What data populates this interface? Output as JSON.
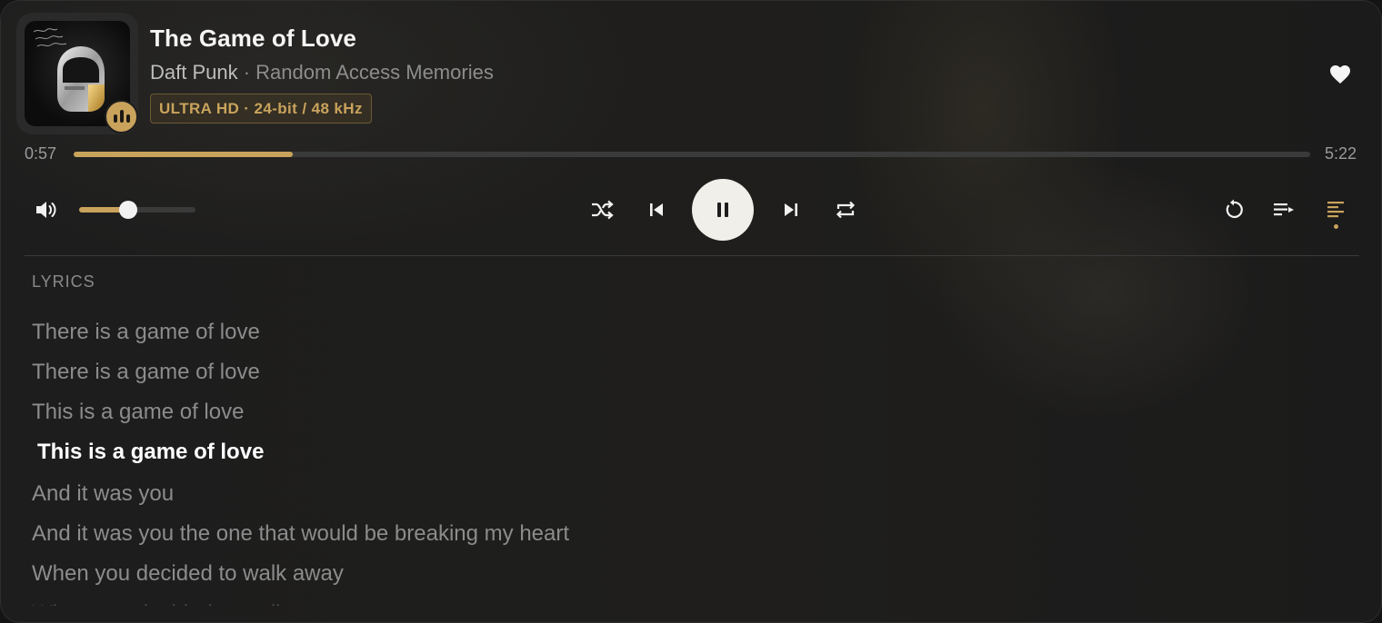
{
  "track": {
    "title": "The Game of Love",
    "artist": "Daft Punk",
    "separator": " · ",
    "album": "Random Access Memories",
    "quality": "ULTRA HD · 24-bit / 48 kHz",
    "favorited": true
  },
  "playback": {
    "current_time": "0:57",
    "total_time": "5:22",
    "progress_fraction": 0.177,
    "volume_fraction": 0.42,
    "state": "playing"
  },
  "icons": {
    "heart": "heart-icon",
    "volume": "volume-icon",
    "shuffle": "shuffle-icon",
    "previous": "skip-previous-icon",
    "pause": "pause-icon",
    "next": "skip-next-icon",
    "repeat": "repeat-icon",
    "replay": "replay-icon",
    "queue": "queue-icon",
    "lyrics": "lyrics-icon",
    "now_playing": "equalizer-icon"
  },
  "colors": {
    "accent": "#c9a35c",
    "background": "#1d1d1d",
    "text_primary": "#f5f5f5",
    "text_muted": "#8c8c8c"
  },
  "lyrics": {
    "label": "LYRICS",
    "active_index": 3,
    "lines": [
      "There is a game of love",
      "There is a game of love",
      "This is a game of love",
      "This is a game of love",
      "And it was you",
      "And it was you the one that would be breaking my heart",
      "When you decided to walk away",
      "When you decided to walk away"
    ]
  }
}
